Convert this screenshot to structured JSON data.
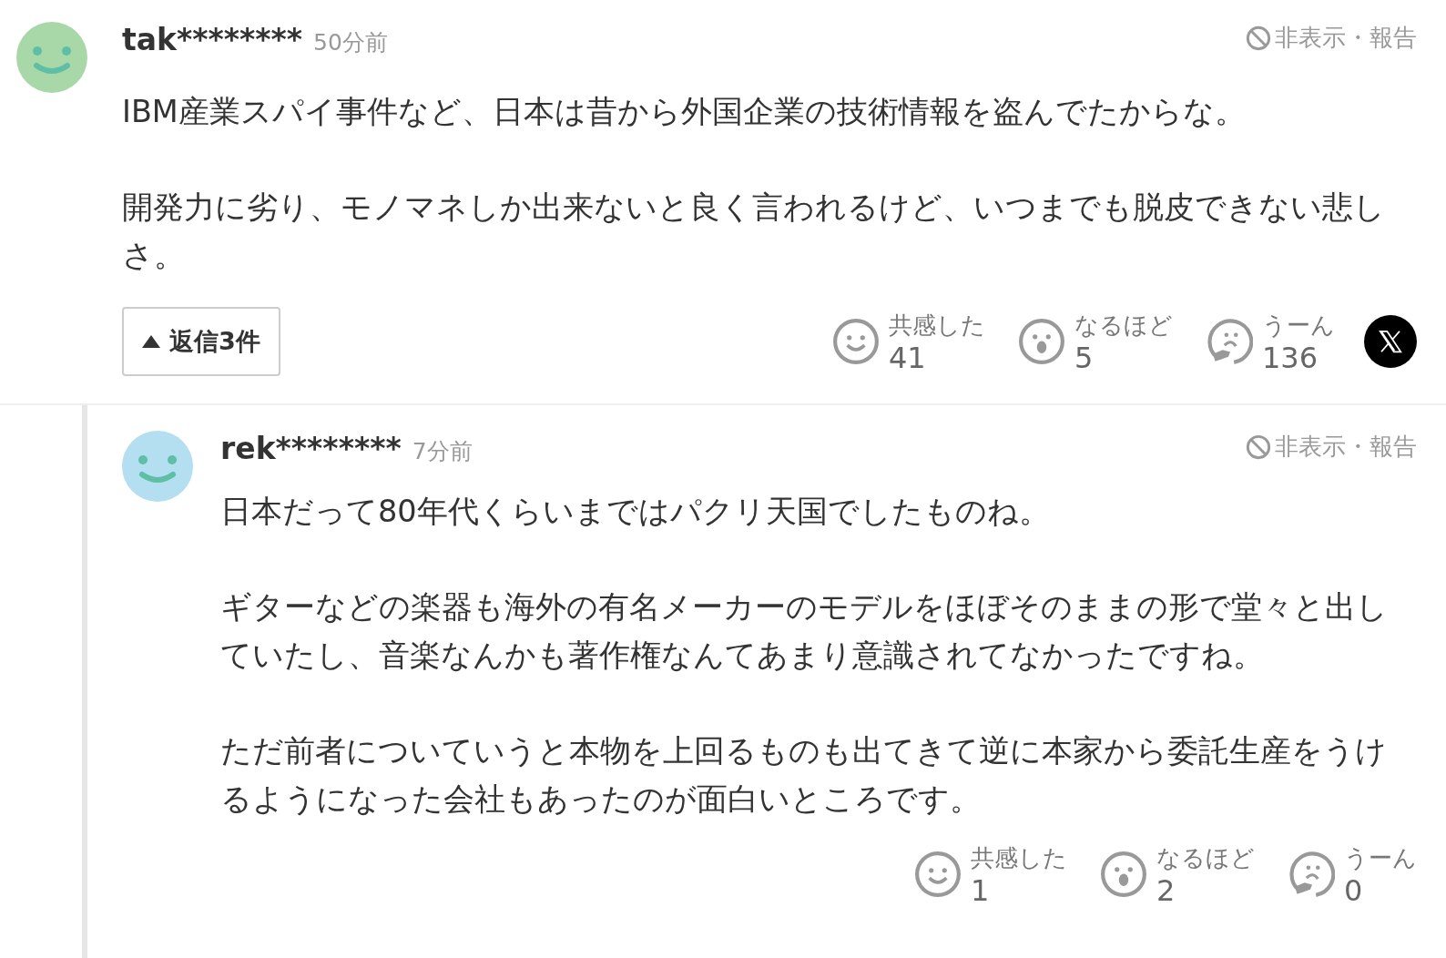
{
  "comments": [
    {
      "user": "tak********",
      "time": "50分前",
      "color": "#a8d8a8",
      "hide_report": "非表示・報告",
      "paragraphs": [
        "IBM産業スパイ事件など、日本は昔から外国企業の技術情報を盗んでたからな。",
        "開発力に劣り、モノマネしか出来ないと良く言われるけど、いつまでも脱皮できない悲しさ。"
      ],
      "reply_button": {
        "label": "返信3件",
        "expanded": true
      },
      "reactions": [
        {
          "kind": "smile",
          "label": "共感した",
          "count": "41"
        },
        {
          "kind": "surprise",
          "label": "なるほど",
          "count": "5"
        },
        {
          "kind": "think",
          "label": "うーん",
          "count": "136"
        }
      ],
      "share_x": true,
      "replies": [
        {
          "user": "rek********",
          "time": "7分前",
          "color": "#b3dff0",
          "hide_report": "非表示・報告",
          "paragraphs": [
            "日本だって80年代くらいまではパクリ天国でしたものね。",
            "ギターなどの楽器も海外の有名メーカーのモデルをほぼそのままの形で堂々と出していたし、音楽なんかも著作権なんてあまり意識されてなかったですね。",
            "ただ前者についていうと本物を上回るものも出てきて逆に本家から委託生産をうけるようになった会社もあったのが面白いところです。"
          ],
          "reactions": [
            {
              "kind": "smile",
              "label": "共感した",
              "count": "1"
            },
            {
              "kind": "surprise",
              "label": "なるほど",
              "count": "2"
            },
            {
              "kind": "think",
              "label": "うーん",
              "count": "0"
            }
          ]
        }
      ]
    }
  ]
}
